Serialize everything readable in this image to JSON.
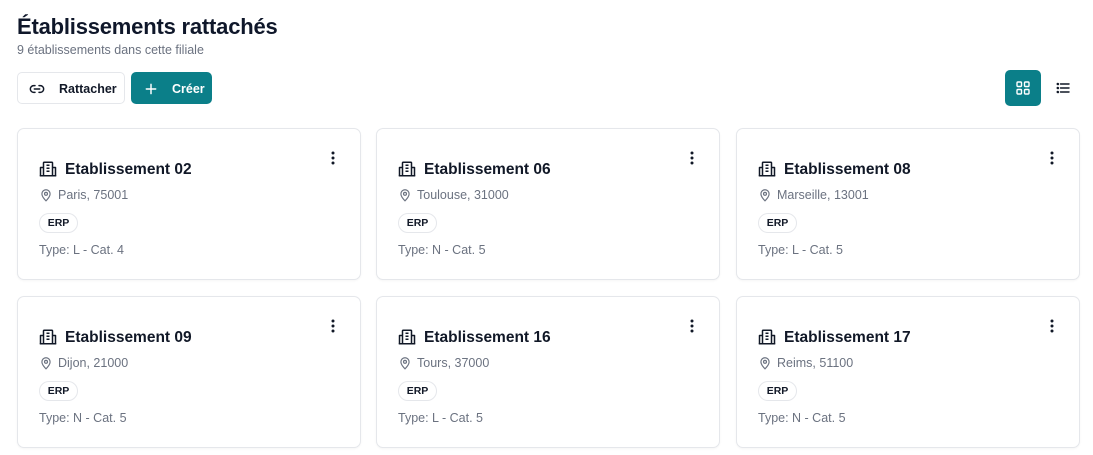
{
  "header": {
    "title": "Établissements rattachés",
    "subtitle": "9 établissements dans cette filiale"
  },
  "toolbar": {
    "attach_label": "Rattacher",
    "create_label": "Créer",
    "attach_icon": "link-icon",
    "create_icon": "plus-icon",
    "grid_view_icon": "grid-view-icon",
    "list_view_icon": "list-view-icon",
    "active_view": "grid"
  },
  "colors": {
    "accent": "#0b7f89",
    "muted_text": "#6b7280",
    "border": "#e5e7eb"
  },
  "cards": [
    {
      "name": "Etablissement 02",
      "location": "Paris, 75001",
      "badge": "ERP",
      "type": "Type: L - Cat. 4"
    },
    {
      "name": "Etablissement 06",
      "location": "Toulouse, 31000",
      "badge": "ERP",
      "type": "Type: N - Cat. 5"
    },
    {
      "name": "Etablissement 08",
      "location": "Marseille, 13001",
      "badge": "ERP",
      "type": "Type: L - Cat. 5"
    },
    {
      "name": "Etablissement 09",
      "location": "Dijon, 21000",
      "badge": "ERP",
      "type": "Type: N - Cat. 5"
    },
    {
      "name": "Etablissement 16",
      "location": "Tours, 37000",
      "badge": "ERP",
      "type": "Type: L - Cat. 5"
    },
    {
      "name": "Etablissement 17",
      "location": "Reims, 51100",
      "badge": "ERP",
      "type": "Type: N - Cat. 5"
    }
  ]
}
